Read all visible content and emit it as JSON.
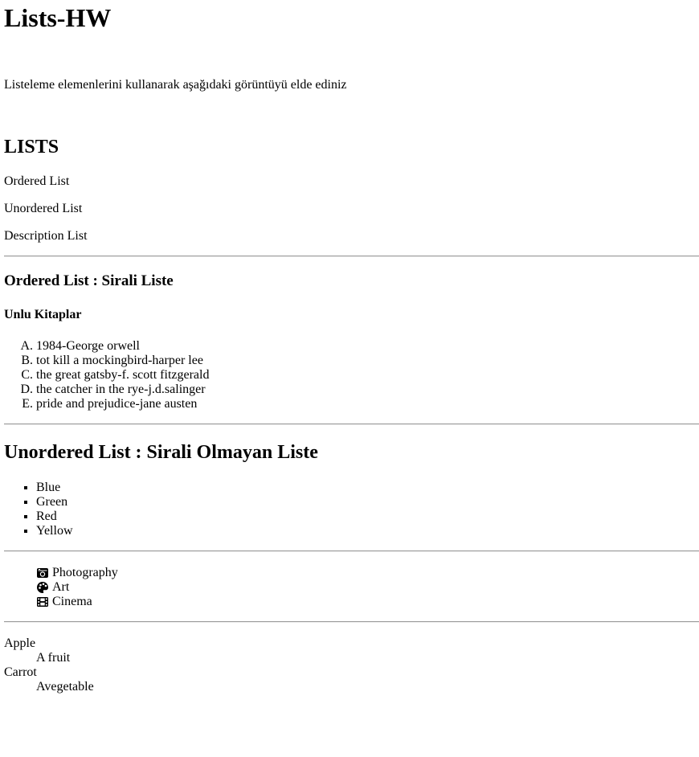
{
  "page": {
    "title": "Lists-HW",
    "intro": "Listeleme elemenlerini kullanarak aşağıdaki görüntüyü elde ediniz"
  },
  "toc": {
    "heading": "LISTS",
    "links": [
      "Ordered List",
      "Unordered List",
      "Description List"
    ]
  },
  "ordered_section": {
    "heading": "Ordered List : Sirali Liste",
    "subheading": "Unlu Kitaplar",
    "items": [
      "1984-George orwell",
      "tot kill a mockingbird-harper lee",
      "the great gatsby-f. scott fitzgerald",
      "the catcher in the rye-j.d.salinger",
      "pride and prejudice-jane austen"
    ]
  },
  "unordered_section": {
    "heading": "Unordered List : Sirali Olmayan Liste",
    "colors": [
      "Blue",
      "Green",
      "Red",
      "Yellow"
    ],
    "icon_items": [
      {
        "icon": "camera-retro-icon",
        "label": "Photography"
      },
      {
        "icon": "palette-icon",
        "label": "Art"
      },
      {
        "icon": "film-icon",
        "label": "Cinema"
      }
    ]
  },
  "description_section": {
    "items": [
      {
        "term": "Apple",
        "desc": "A fruit"
      },
      {
        "term": "Carrot",
        "desc": "Avegetable"
      }
    ]
  }
}
